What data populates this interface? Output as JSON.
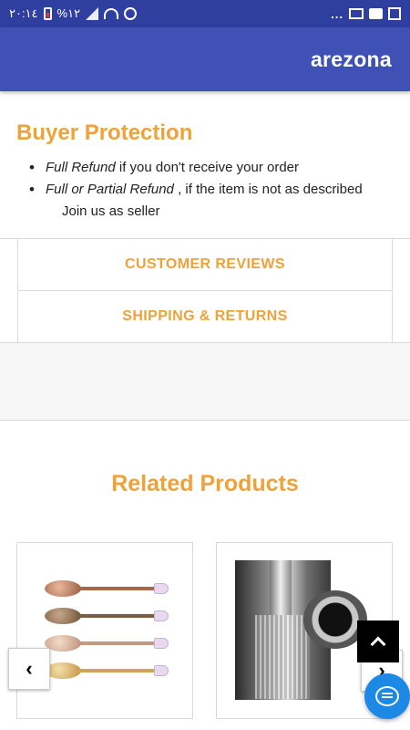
{
  "status_bar": {
    "time": "٢٠:١٤",
    "battery": "%١٢",
    "more": "..."
  },
  "app_bar": {
    "title": "arezona"
  },
  "buyer_protection": {
    "heading": "Buyer Protection",
    "items": [
      {
        "emphasis": "Full Refund",
        "text": " if you don't receive your order"
      },
      {
        "emphasis": "Full or Partial Refund",
        "text": " , if the item is not as described"
      }
    ],
    "join": "Join us as seller"
  },
  "tabs": [
    {
      "label": "CUSTOMER REVIEWS"
    },
    {
      "label": "SHIPPING & RETURNS"
    }
  ],
  "related": {
    "title": "Related Products"
  },
  "controls": {
    "prev": "‹",
    "next": "›"
  },
  "colors": {
    "accent": "#eea23a",
    "app_bar": "#3f51b5",
    "status_bar": "#2f3fa0",
    "chat_fab": "#1e88e5"
  }
}
